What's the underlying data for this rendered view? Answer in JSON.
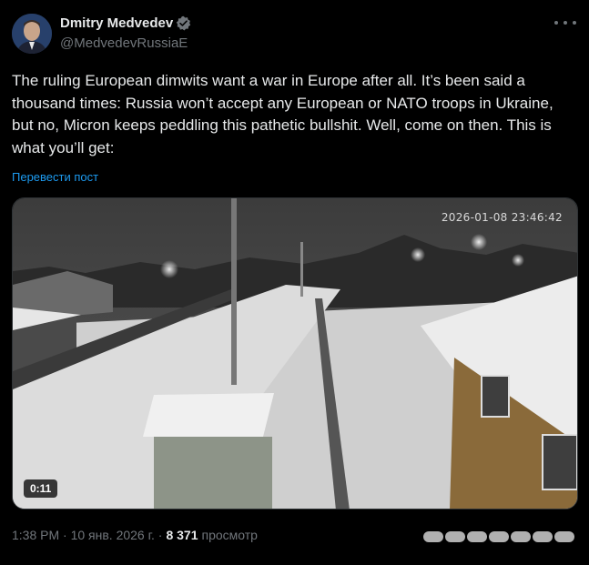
{
  "author": {
    "display_name": "Dmitry Medvedev",
    "handle": "@MedvedevRussiaE",
    "verified": true
  },
  "tweet": {
    "text": "The ruling European dimwits want a war in Europe after all. It’s been said a thousand times: Russia won’t accept any European or NATO troops in Ukraine, but no, Micron keeps peddling this pathetic bullshit. Well, come on then. This is what you’ll get:",
    "translate_label": "Перевести пост"
  },
  "media": {
    "overlay_timestamp": "2026-01-08 23:46:42",
    "duration": "0:11"
  },
  "meta": {
    "time_date": "1:38 PM · 10 янв. 2026 г. ·",
    "views_count": "8 371",
    "views_label": "просмотр"
  },
  "colors": {
    "background": "#000000",
    "text": "#e7e9ea",
    "secondary_text": "#71767b",
    "link": "#1d9bf0",
    "verified_badge": "#71767b"
  },
  "icons": [
    "more-icon",
    "verified-badge-icon"
  ]
}
